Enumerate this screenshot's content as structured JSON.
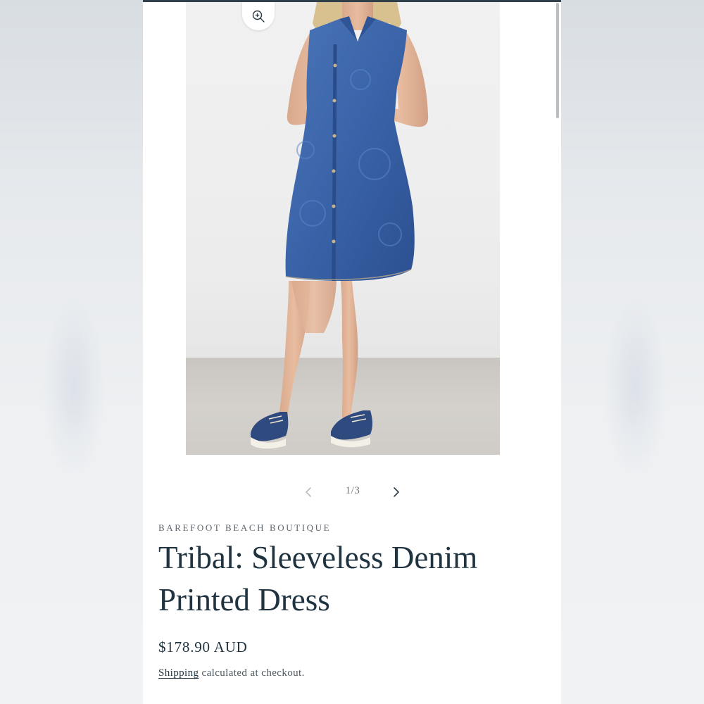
{
  "product_media": {
    "zoom_icon": "zoom-in-icon",
    "image_alt": "Model wearing sleeveless denim printed dress with denim sneakers"
  },
  "slider": {
    "prev_icon": "chevron-left-icon",
    "next_icon": "chevron-right-icon",
    "counter": "1/3",
    "current": 1,
    "total": 3
  },
  "product": {
    "vendor": "BAREFOOT BEACH BOUTIQUE",
    "title": "Tribal: Sleeveless Denim Printed Dress",
    "price": "$178.90 AUD",
    "shipping_link": "Shipping",
    "shipping_suffix": " calculated at checkout."
  },
  "colors": {
    "text_primary": "#1f3340",
    "denim": "#3a63a8",
    "accent_bar": "#30404a"
  }
}
